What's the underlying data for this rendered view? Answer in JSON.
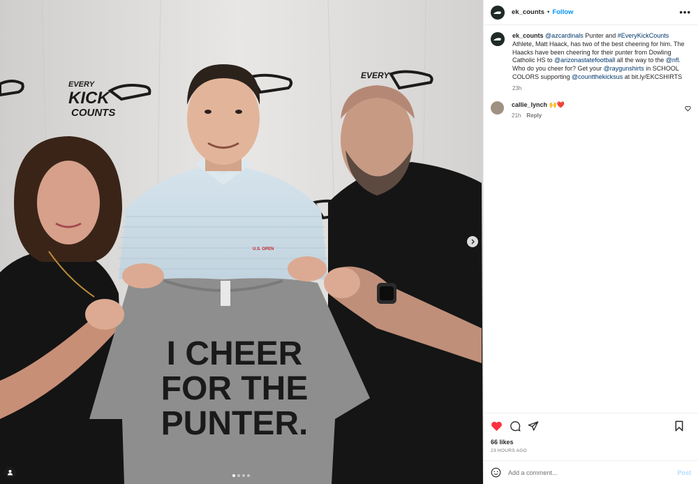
{
  "post": {
    "username": "ek_counts",
    "follow_label": "Follow",
    "more_label": "•••",
    "caption": {
      "username": "ek_counts",
      "parts": [
        {
          "t": "@azcardinals",
          "link": true
        },
        {
          "t": " Punter and ",
          "link": false
        },
        {
          "t": "#EveryKickCounts",
          "link": true
        },
        {
          "t": " Athlete, Matt Haack, has two of the best cheering for him. The Haacks have been cheering for their punter from Dowling Catholic HS to ",
          "link": false
        },
        {
          "t": "@arizonastatefootball",
          "link": true
        },
        {
          "t": " all the way to the ",
          "link": false
        },
        {
          "t": "@nfl",
          "link": true
        },
        {
          "t": ". Who do you cheer for? Get your ",
          "link": false
        },
        {
          "t": "@raygunshirts",
          "link": true
        },
        {
          "t": " in SCHOOL COLORS supporting ",
          "link": false
        },
        {
          "t": "@countthekicksus",
          "link": true
        },
        {
          "t": " at bit.ly/EKCSHIRTS",
          "link": false
        }
      ],
      "time": "23h"
    },
    "comments": [
      {
        "username": "callie_lynch",
        "text": "🙌❤️",
        "time": "21h",
        "reply_label": "Reply"
      }
    ],
    "likes": "66 likes",
    "posted_ago": "23 HOURS AGO",
    "add_comment_placeholder": "Add a comment...",
    "post_label": "Post"
  },
  "photo": {
    "backdrop_logo_lines": [
      "EVERY",
      "KICK",
      "COUNTS"
    ],
    "shirt_lines": [
      "I CHEER",
      "FOR THE",
      "PUNTER."
    ],
    "polo_logo": "U.S. OPEN",
    "carousel": {
      "count": 4,
      "active": 1
    }
  },
  "colors": {
    "accent_blue": "#0095f6",
    "link": "#00376b",
    "like_red": "#ff3040",
    "muted": "#737373"
  },
  "icons": {
    "like": "heart-filled-icon",
    "comment": "comment-bubble-icon",
    "share": "paper-plane-icon",
    "save": "bookmark-icon",
    "emoji": "smiley-icon",
    "next": "chevron-right-icon",
    "tag": "user-tag-icon"
  }
}
